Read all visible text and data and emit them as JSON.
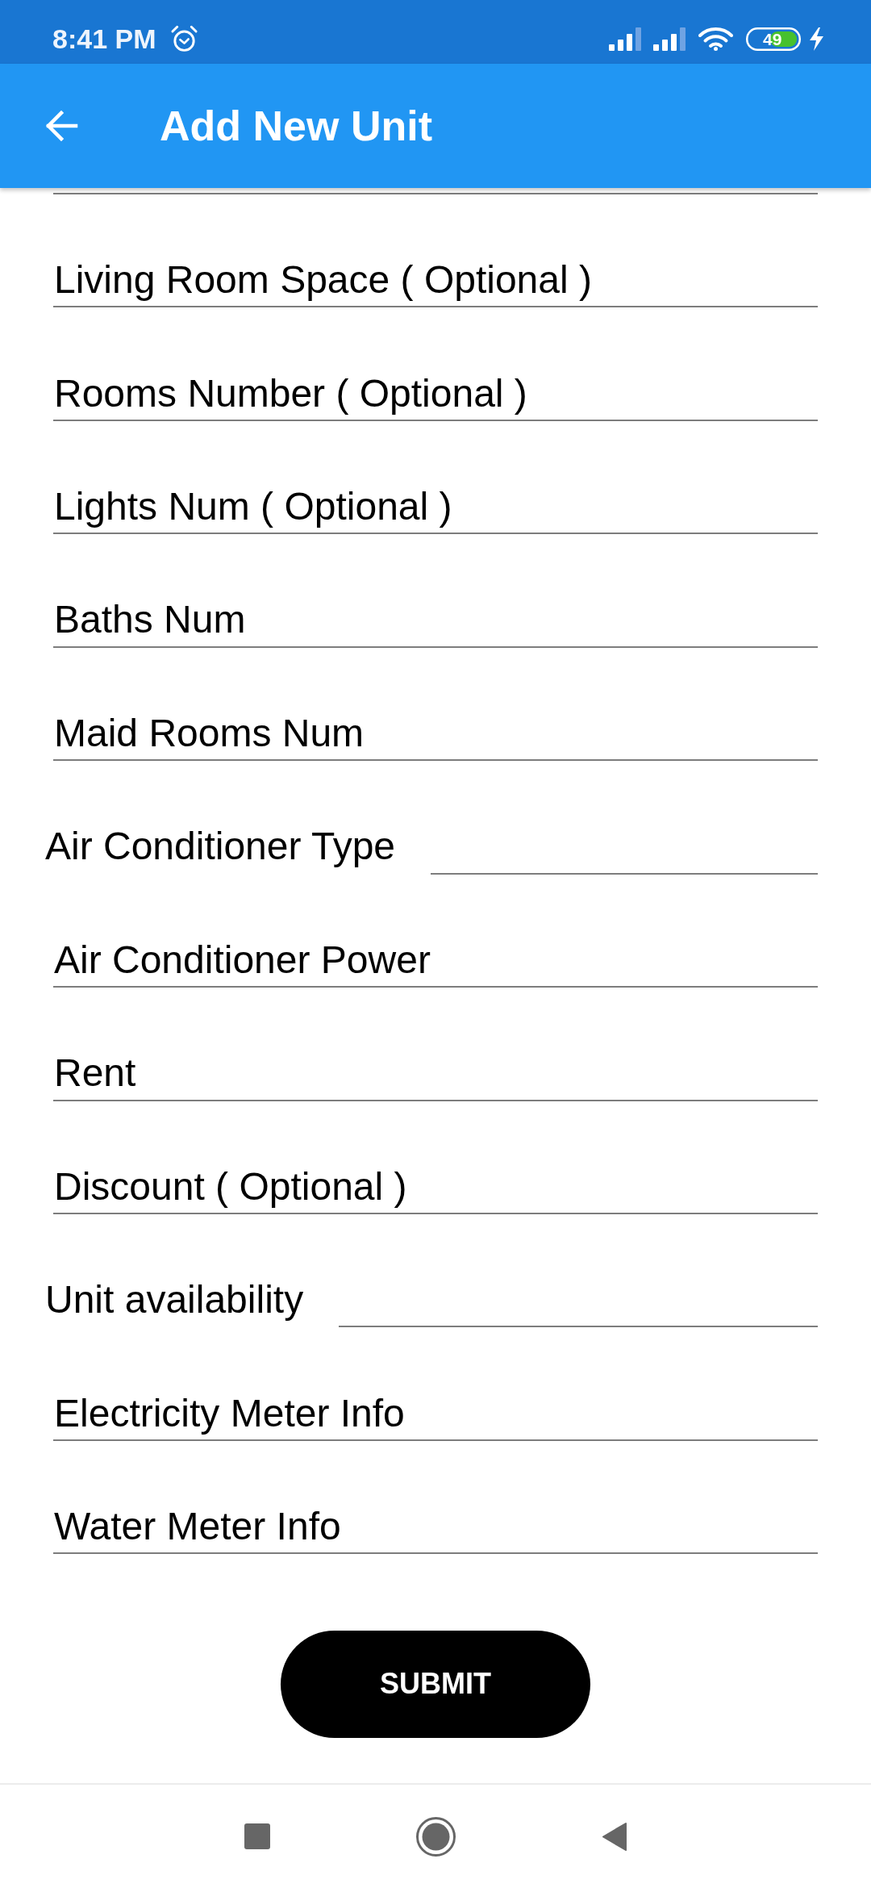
{
  "status_bar": {
    "time": "8:41 PM",
    "battery": "49"
  },
  "app_bar": {
    "title": "Add New Unit"
  },
  "form": {
    "fields": [
      {
        "kind": "clipped"
      },
      {
        "kind": "text",
        "placeholder": "Living Room Space ( Optional )"
      },
      {
        "kind": "text",
        "placeholder": "Rooms Number ( Optional )"
      },
      {
        "kind": "text",
        "placeholder": "Lights Num ( Optional )"
      },
      {
        "kind": "text",
        "placeholder": "Baths Num"
      },
      {
        "kind": "text",
        "placeholder": "Maid Rooms Num"
      },
      {
        "kind": "spinner",
        "label": "Air Conditioner Type"
      },
      {
        "kind": "text",
        "placeholder": "Air Conditioner Power"
      },
      {
        "kind": "text",
        "placeholder": "Rent"
      },
      {
        "kind": "text",
        "placeholder": "Discount ( Optional )"
      },
      {
        "kind": "spinner",
        "label": "Unit availability"
      },
      {
        "kind": "text",
        "placeholder": "Electricity Meter Info"
      },
      {
        "kind": "text",
        "placeholder": "Water Meter Info"
      }
    ]
  },
  "submit_button": {
    "label": "SUBMIT"
  }
}
